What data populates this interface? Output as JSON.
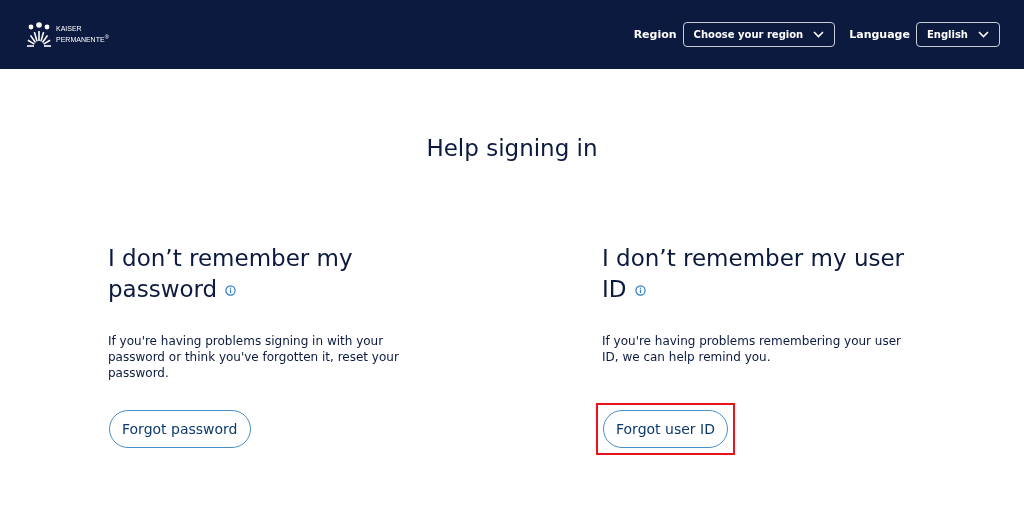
{
  "header": {
    "logo": {
      "line_1": "KAISER",
      "line_2": "PERMANENTE",
      "mark": "®"
    },
    "selectors": [
      {
        "label": "Region",
        "value": "Choose your region"
      },
      {
        "label": "Language",
        "value": "English"
      }
    ]
  },
  "title": "Help signing in",
  "options": [
    {
      "heading": "I don’t remember my password",
      "text": "If you're having problems signing in with your password or think you've forgotten it, reset your password.",
      "button": "Forgot password",
      "highlighted": false
    },
    {
      "heading": "I don’t remember my user ID",
      "text": "If you're having problems remembering your user ID, we can help remind you.",
      "button": "Forgot user ID",
      "highlighted": true
    }
  ]
}
